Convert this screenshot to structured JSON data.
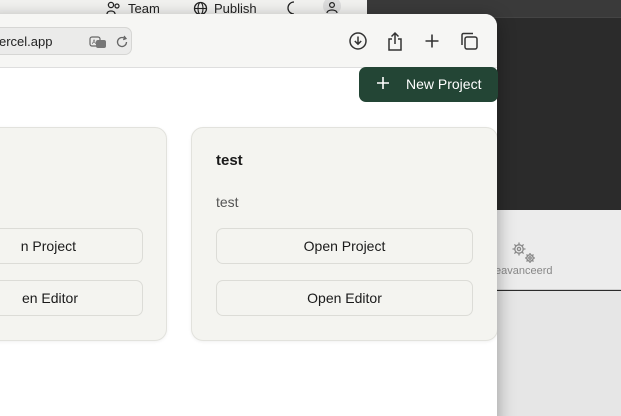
{
  "background_window": {
    "team_label": "Team",
    "publish_label": "Publish"
  },
  "right_panel": {
    "settings_label": "eavanceerd"
  },
  "browser": {
    "url": "ercel.app",
    "toolbar_icons": [
      "download-icon",
      "share-icon",
      "new-tab-icon",
      "tab-overview-icon"
    ]
  },
  "page": {
    "new_project_label": "New Project",
    "cards": [
      {
        "title": "",
        "description": "",
        "open_project_label": "n Project",
        "open_editor_label": "en Editor"
      },
      {
        "title": "test",
        "description": "test",
        "open_project_label": "Open Project",
        "open_editor_label": "Open Editor"
      }
    ]
  },
  "colors": {
    "accent": "#234535",
    "card_bg": "#f4f4f0",
    "page_bg": "#ffffff"
  }
}
